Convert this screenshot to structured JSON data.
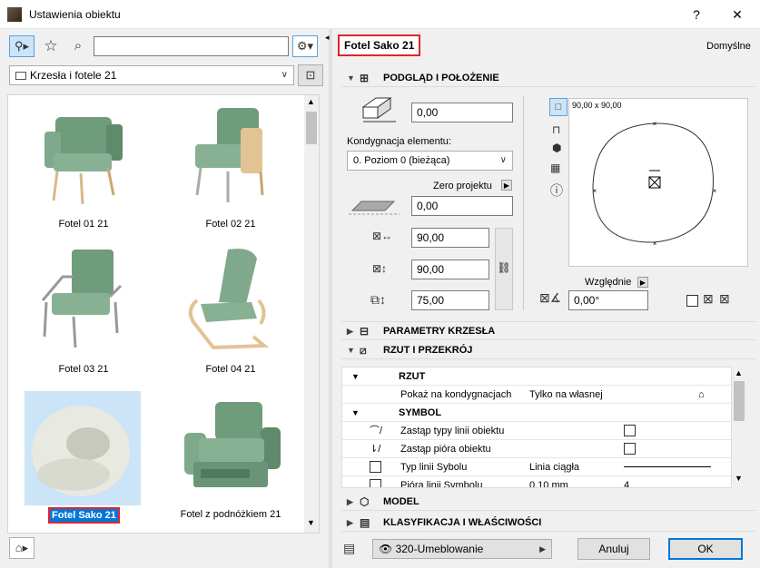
{
  "window": {
    "title": "Ustawienia obiektu",
    "help": "?",
    "close": "✕"
  },
  "search": {
    "value": "",
    "placeholder": ""
  },
  "library": {
    "folder": "Krzesła i fotele 21"
  },
  "items": [
    {
      "label": "Fotel 01 21"
    },
    {
      "label": "Fotel 02 21"
    },
    {
      "label": "Fotel 03 21"
    },
    {
      "label": "Fotel 04 21"
    },
    {
      "label": "Fotel Sako 21"
    },
    {
      "label": "Fotel z podnóżkiem 21"
    }
  ],
  "header": {
    "selected_name": "Fotel Sako 21",
    "defaults_label": "Domyślne"
  },
  "sections": {
    "preview": "PODGLĄD I POŁOŻENIE",
    "chair": "PARAMETRY KRZESŁA",
    "plan": "RZUT I PRZEKRÓJ",
    "model": "MODEL",
    "classification": "KLASYFIKACJA I WŁAŚCIWOŚCI"
  },
  "position": {
    "offset": "0,00",
    "story_label": "Kondygnacja elementu:",
    "story_value": "0. Poziom 0 (bieżąca)",
    "zero_label": "Zero projektu",
    "zero_value": "0,00",
    "width": "90,00",
    "depth": "90,00",
    "height": "75,00",
    "relative_label": "Względnie",
    "angle": "0,00°",
    "preview_size": "90,00 x 90,00"
  },
  "plan_table": {
    "rzut_header": "RZUT",
    "show_on_label": "Pokaż na kondygnacjach",
    "show_on_value": "Tylko na własnej",
    "symbol_header": "SYMBOL",
    "override_line_types": "Zastąp typy linii obiektu",
    "override_pens": "Zastąp pióra obiektu",
    "line_type_label": "Typ linii Sybolu",
    "line_type_value": "Linia ciągła",
    "pens_label": "Pióra linii Symbolu",
    "pens_value": "0,10 mm",
    "pens_num": "4"
  },
  "footer": {
    "layer": "320-Umeblowanie",
    "cancel": "Anuluj",
    "ok": "OK"
  },
  "colors": {
    "accent": "#0078d7",
    "highlight": "#e0242a",
    "chair_green": "#7fa98a"
  }
}
